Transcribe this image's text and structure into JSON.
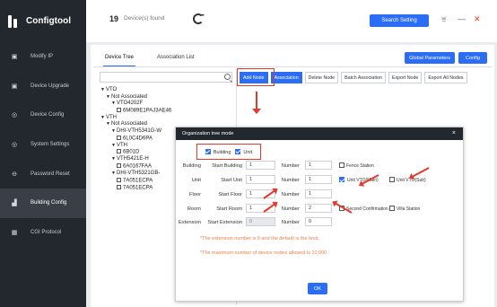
{
  "app": {
    "title": "Configtool"
  },
  "sidebar": {
    "items": [
      {
        "label": "Modify IP",
        "icon": "modify-ip-icon",
        "glyph": "▣"
      },
      {
        "label": "Device Upgrade",
        "icon": "upgrade-icon",
        "glyph": "▣"
      },
      {
        "label": "Device Config",
        "icon": "device-config-icon",
        "glyph": "◎"
      },
      {
        "label": "System Settings",
        "icon": "system-settings-icon",
        "glyph": "◎"
      },
      {
        "label": "Password Reset",
        "icon": "password-reset-icon",
        "glyph": "⊖"
      },
      {
        "label": "Building Config",
        "icon": "building-config-icon",
        "glyph": "▟",
        "active": true
      },
      {
        "label": "CGI Protocol",
        "icon": "cgi-protocol-icon",
        "glyph": "▦"
      }
    ]
  },
  "topbar": {
    "device_count": "19",
    "device_label": "Device(s) found",
    "search_button": "Search Setting",
    "win_menu": "⩸",
    "win_min": "—",
    "win_close": "✕"
  },
  "panel": {
    "tabs": [
      "Device Tree",
      "Association List"
    ],
    "global_params": "Global Parameters",
    "config": "Config",
    "toolbar": [
      "Add Node",
      "Association",
      "Delete Node",
      "Batch Association",
      "Export Node",
      "Export All Nodes"
    ]
  },
  "tree": [
    {
      "text": "VTO",
      "indent": 0,
      "type": "open"
    },
    {
      "text": "Not Associated",
      "indent": 1,
      "type": "open"
    },
    {
      "text": "VTO4202F",
      "indent": 2,
      "type": "open"
    },
    {
      "text": "6M089E1PAJ3AE46",
      "indent": 3,
      "type": "check"
    },
    {
      "text": "VTH",
      "indent": 0,
      "type": "open"
    },
    {
      "text": "Not Associated",
      "indent": 1,
      "type": "open"
    },
    {
      "text": "DHI-VTH5341G-W",
      "indent": 2,
      "type": "open"
    },
    {
      "text": "6L0C4D6PA",
      "indent": 3,
      "type": "check"
    },
    {
      "text": "VTH",
      "indent": 2,
      "type": "open"
    },
    {
      "text": "6B01D",
      "indent": 3,
      "type": "check"
    },
    {
      "text": "VTH5421E-H",
      "indent": 2,
      "type": "open"
    },
    {
      "text": "6A0167FAA",
      "indent": 3,
      "type": "check"
    },
    {
      "text": "DHI-VTH5321GB-",
      "indent": 2,
      "type": "open"
    },
    {
      "text": "7A051ECPA",
      "indent": 3,
      "type": "check"
    },
    {
      "text": "7A051ECPA",
      "indent": 3,
      "type": "check"
    }
  ],
  "dialog": {
    "title": "Organization tree mode",
    "close": "×",
    "mode_building": "Building",
    "mode_unit": "Unit",
    "rows": {
      "building": {
        "label": "Building",
        "start_label": "Start Building",
        "start_value": "1",
        "num_label": "Number",
        "num_value": "1",
        "option": "Fence Station"
      },
      "unit": {
        "label": "Unit",
        "start_label": "Start Unit",
        "start_value": "1",
        "num_label": "Number",
        "num_value": "1",
        "option1": "Unit VTO(Main)",
        "option2": "Unit VTO(Sub)"
      },
      "floor": {
        "label": "Floor",
        "start_label": "Start Floor",
        "start_value": "1",
        "num_label": "Number",
        "num_value": "1"
      },
      "room": {
        "label": "Room",
        "start_label": "Start Room",
        "start_value": "1",
        "num_label": "Number",
        "num_value": "2",
        "option1": "Second Confirmation",
        "option2": "Villa Station"
      },
      "extension": {
        "label": "Extension",
        "start_label": "Start Extension",
        "start_value": "0",
        "num_label": "Number",
        "num_value": "0"
      }
    },
    "note1": "*The extension number is 0 and the default is the host.",
    "note2": "*The maximum number of device nodes allowed is 10,000.",
    "ok": "OK"
  },
  "colors": {
    "accent": "#2b6ef5",
    "sidebar": "#23272e",
    "highlight": "#e53a2a",
    "note": "#f07b47"
  }
}
